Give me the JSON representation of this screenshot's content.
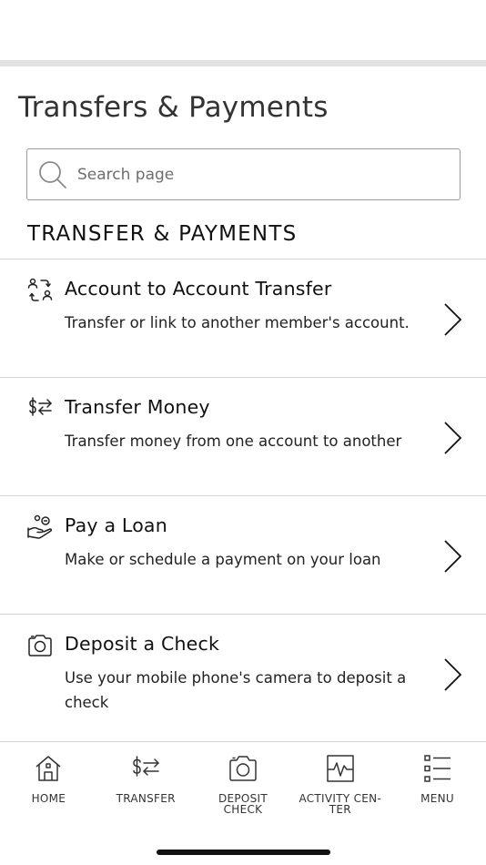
{
  "page": {
    "title": "Transfers & Payments"
  },
  "search": {
    "placeholder": "Search page"
  },
  "section": {
    "header": "TRANSFER & PAYMENTS"
  },
  "items": [
    {
      "icon": "account-transfer-icon",
      "title": "Account to Account Transfer",
      "description": "Transfer or link to another member's account."
    },
    {
      "icon": "dollar-exchange-icon",
      "title": "Transfer Money",
      "description": "Transfer money from one account to another"
    },
    {
      "icon": "hand-coins-icon",
      "title": "Pay a Loan",
      "description": "Make or schedule a payment on your loan"
    },
    {
      "icon": "camera-icon",
      "title": "Deposit a Check",
      "description": "Use your mobile phone's camera to deposit a check"
    }
  ],
  "nav": [
    {
      "icon": "home-icon",
      "label": "HOME"
    },
    {
      "icon": "dollar-exchange-icon",
      "label": "TRANSFER"
    },
    {
      "icon": "camera-icon",
      "label": "DEPOSIT CHECK"
    },
    {
      "icon": "activity-icon",
      "label": "ACTIVITY CEN-\nTER"
    },
    {
      "icon": "menu-list-icon",
      "label": "MENU"
    }
  ]
}
